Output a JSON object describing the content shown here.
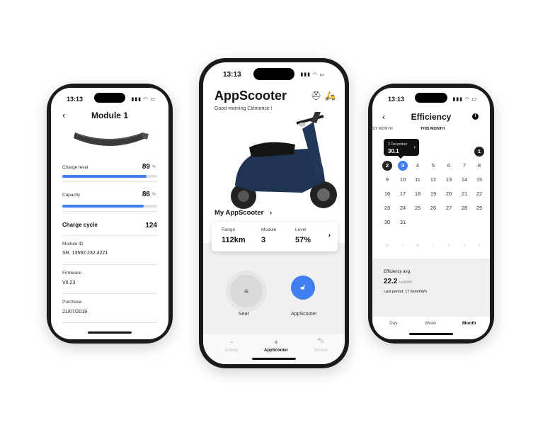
{
  "status": {
    "time": "13:13",
    "signal": "▮▮▮ ◠ ▭"
  },
  "module": {
    "title": "Module 1",
    "charge_level": {
      "label": "Charge level",
      "value": "89",
      "unit": "%",
      "fill": 0.89
    },
    "capacity": {
      "label": "Capacity",
      "value": "86",
      "unit": "%",
      "fill": 0.86
    },
    "charge_cycle": {
      "label": "Charge cycle",
      "value": "124"
    },
    "module_id": {
      "label": "Module ID",
      "value": "SR. 13592.232.4221"
    },
    "firmware": {
      "label": "Firmware",
      "value": "V0.23"
    },
    "purchase": {
      "label": "Purchase",
      "value": "21/07/2019"
    }
  },
  "home": {
    "title": "AppScooter",
    "greeting": "Good morning Clémence !",
    "my_scooter": "My AppScooter",
    "range": {
      "label": "Range",
      "value": "112km"
    },
    "module": {
      "label": "Module",
      "value": "3"
    },
    "level": {
      "label": "Level",
      "value": "57%"
    },
    "seat_label": "Seat",
    "scooter_label": "AppScooter",
    "tabs": [
      {
        "label": "Activity"
      },
      {
        "label": "AppScooter"
      },
      {
        "label": "Service"
      }
    ]
  },
  "efficiency": {
    "title": "Efficiency",
    "last_month": "ST MONTH",
    "this_month": "THIS MONTH",
    "tooltip_date": "3 December",
    "tooltip_value": "30.1",
    "days": [
      "1",
      "2",
      "3",
      "4",
      "5",
      "6",
      "7",
      "8",
      "9",
      "10",
      "11",
      "12",
      "13",
      "14",
      "15",
      "16",
      "17",
      "18",
      "19",
      "20",
      "21",
      "22",
      "23",
      "24",
      "25",
      "26",
      "27",
      "28",
      "29",
      "30",
      "31"
    ],
    "weekdays": [
      "M",
      "T",
      "W",
      "T",
      "F",
      "S",
      "S"
    ],
    "avg_label": "Efficiency avg.",
    "avg_value": "22.2",
    "avg_unit": "km/kWh",
    "last_period": "Last period: 17.5km/kWh",
    "tabs": [
      "Day",
      "Week",
      "Month"
    ]
  }
}
